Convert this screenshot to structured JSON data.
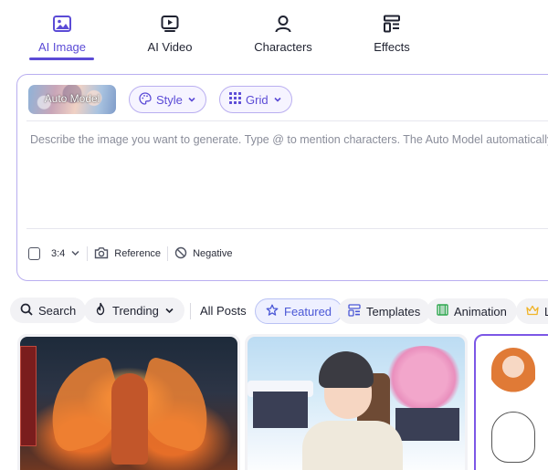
{
  "tabs": [
    {
      "label": "AI Image",
      "icon": "image-icon",
      "active": true
    },
    {
      "label": "AI Video",
      "icon": "video-play-icon",
      "active": false
    },
    {
      "label": "Characters",
      "icon": "person-icon",
      "active": false
    },
    {
      "label": "Effects",
      "icon": "effects-layout-icon",
      "active": false
    }
  ],
  "prompt_card": {
    "model_label": "Auto Model",
    "style_label": "Style",
    "grid_label": "Grid",
    "prompt_placeholder": "Describe the image you want to generate. Type @ to mention characters. The Auto Model automatically",
    "aspect_ratio": "3:4",
    "reference_label": "Reference",
    "negative_label": "Negative"
  },
  "filters": {
    "search_label": "Search",
    "trending_label": "Trending",
    "all_posts_label": "All Posts",
    "featured_label": "Featured",
    "templates_label": "Templates",
    "animation_label": "Animation",
    "last_label": "L"
  },
  "colors": {
    "accent": "#5b4bd6",
    "card_border": "#b9aef0",
    "featured_bg": "#eef0ff",
    "animation_icon": "#2fa84f",
    "crown_icon": "#f0b429"
  }
}
